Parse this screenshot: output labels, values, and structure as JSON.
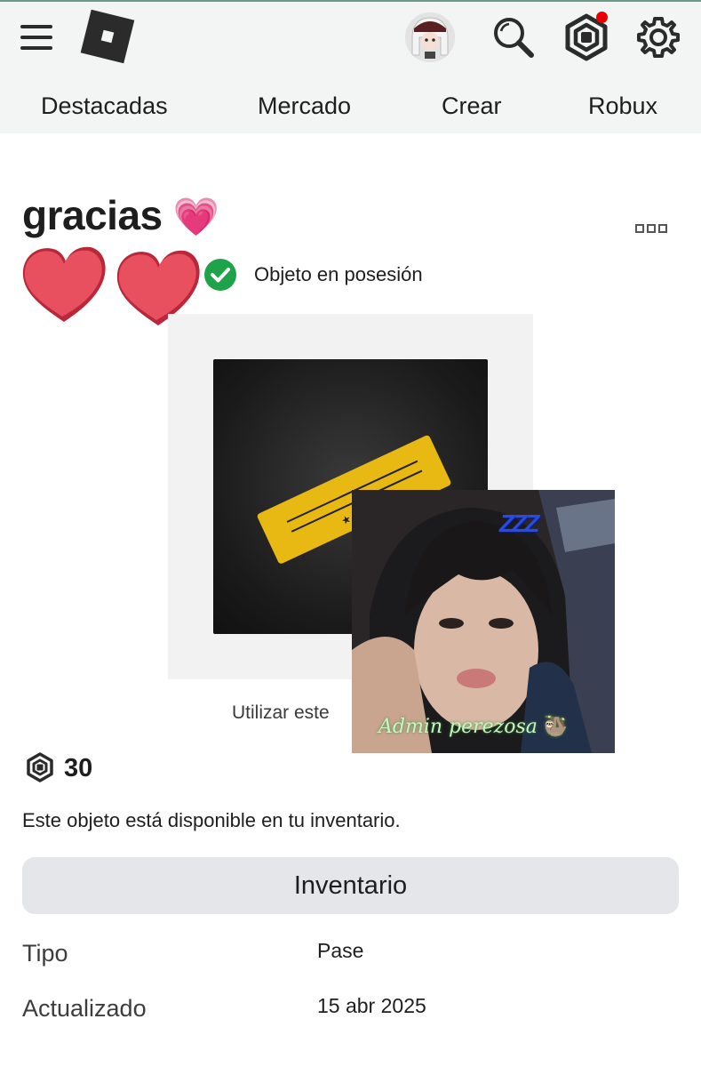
{
  "nav": {
    "items": [
      {
        "label": "Destacadas"
      },
      {
        "label": "Mercado"
      },
      {
        "label": "Crear"
      },
      {
        "label": "Robux"
      }
    ],
    "notification_dot_color": "#e60000"
  },
  "item": {
    "title": "gracias",
    "title_emoji": "💗",
    "owned_label": "Objeto en posesión",
    "use_label": "Utilizar este",
    "price": "30",
    "availability": "Este objeto está disponible en tu inventario.",
    "inventory_button": "Inventario",
    "details": [
      {
        "label": "Tipo",
        "value": "Pase"
      },
      {
        "label": "Actualizado",
        "value": "15 abr 2025"
      }
    ]
  },
  "overlay": {
    "caption": "Admin perezosa",
    "caption_emoji": "🦥",
    "sleep_text": "ZZZ"
  },
  "colors": {
    "accent_green": "#1ea34a",
    "heart_red": "#e8505f",
    "ticket_yellow": "#e8b813",
    "button_gray": "#e5e6ea"
  }
}
